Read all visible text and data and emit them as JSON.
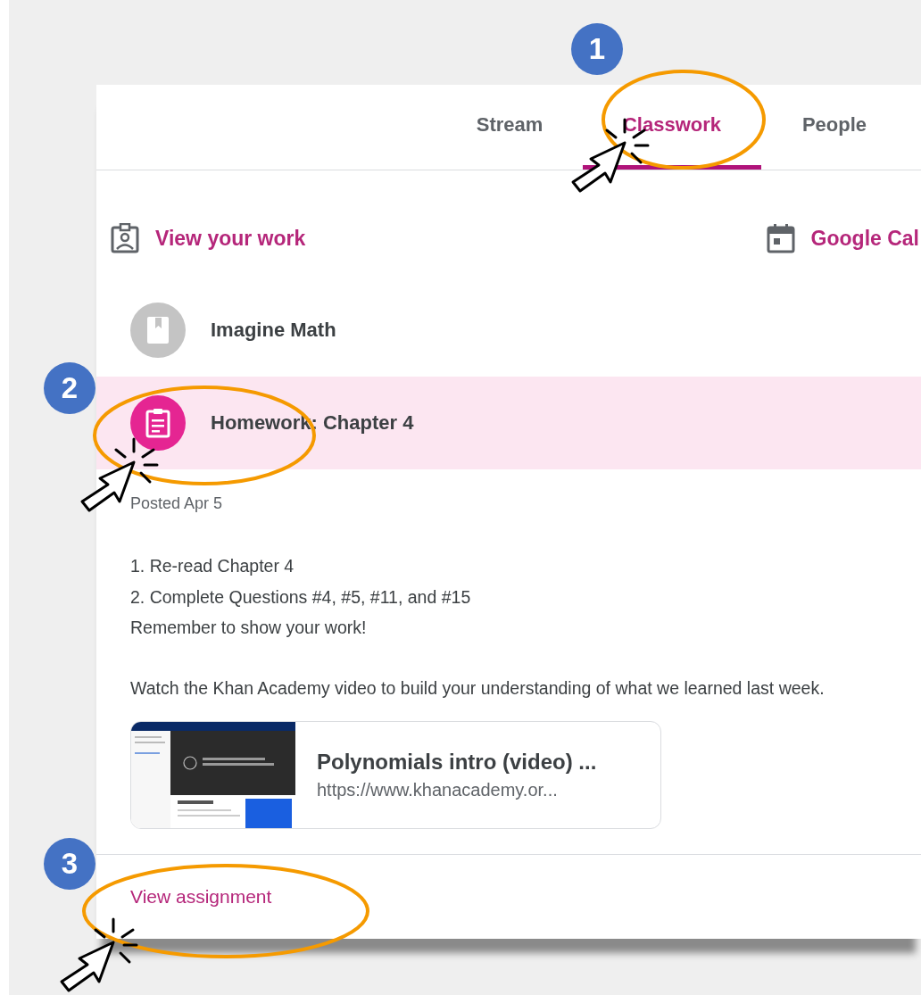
{
  "tabs": [
    {
      "label": "Stream",
      "selected": false
    },
    {
      "label": "Classwork",
      "selected": true
    },
    {
      "label": "People",
      "selected": false
    }
  ],
  "actions": [
    {
      "kind": "work",
      "label": "View your work"
    },
    {
      "kind": "calendar",
      "label": "Google Cal"
    }
  ],
  "topics": [
    {
      "kind": "material",
      "title": "Imagine Math",
      "selected": false
    },
    {
      "kind": "assignment",
      "title": "Homework: Chapter 4",
      "selected": true
    }
  ],
  "details": {
    "posted": "Posted Apr 5",
    "paragraphs": [
      [
        "1. Re-read Chapter 4",
        "2. Complete Questions #4, #5, #11, and #15",
        "Remember to show your work!"
      ],
      [
        "Watch the Khan Academy video to build your understanding of what we learned last week."
      ]
    ],
    "attachment": {
      "title": "Polynomials intro (video) ...",
      "url": "https://www.khanacademy.or..."
    },
    "link": "View assignment"
  },
  "annotations": [
    {
      "number": "1"
    },
    {
      "number": "2"
    },
    {
      "number": "3"
    }
  ]
}
